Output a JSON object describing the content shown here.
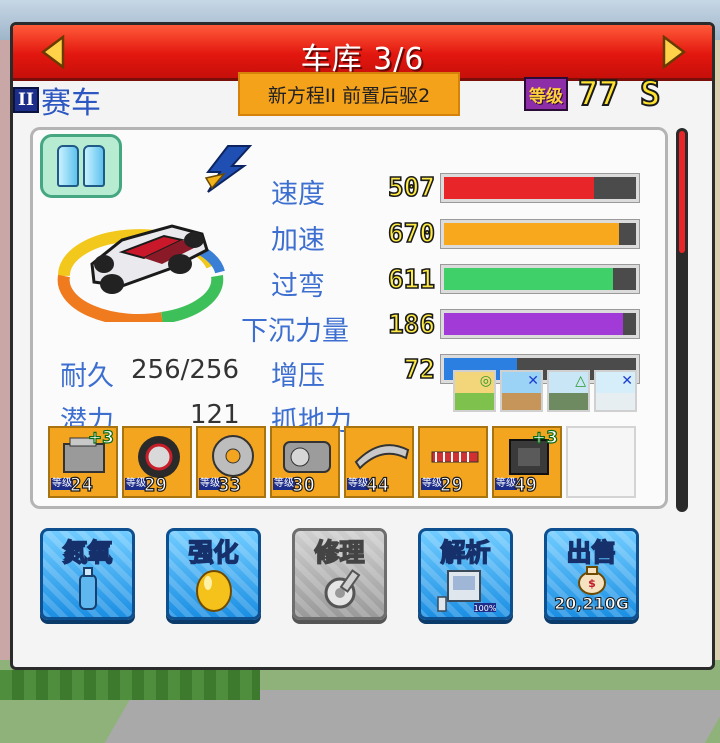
{
  "window": {
    "title": "车库 3/6"
  },
  "car": {
    "rank": "II",
    "name": "赛车",
    "spec": "新方程II 前置后驱2",
    "level_label": "等级",
    "level": "77",
    "grade": "S"
  },
  "stats": [
    {
      "label": "速度",
      "value": "507",
      "fill": 0.78,
      "color": "#e8262a"
    },
    {
      "label": "加速",
      "value": "670",
      "fill": 0.91,
      "color": "#f7a81d"
    },
    {
      "label": "过弯",
      "value": "611",
      "fill": 0.88,
      "color": "#3fd06a"
    },
    {
      "label": "下沉力量",
      "value": "186",
      "fill": 0.93,
      "color": "#a13ad6"
    },
    {
      "label": "增压",
      "value": "72",
      "fill": 0.38,
      "color": "#2a7fe0"
    }
  ],
  "durability": {
    "label": "耐久",
    "value": "256/256"
  },
  "potential": {
    "label": "潜力",
    "value": "121"
  },
  "grip": {
    "label": "抓地力",
    "icons": [
      {
        "name": "sunny-road-grip-icon",
        "mark": "◎",
        "sky": "#f3d57a",
        "ground": "#7ec24d"
      },
      {
        "name": "rain-road-grip-icon",
        "mark": "✕",
        "sky": "#9ad3f5",
        "ground": "#c6955a"
      },
      {
        "name": "rough-road-grip-icon",
        "mark": "△",
        "sky": "#c8e6f6",
        "ground": "#6d8a60"
      },
      {
        "name": "snow-road-grip-icon",
        "mark": "✕",
        "sky": "#d5eef9",
        "ground": "#e7eef2"
      }
    ]
  },
  "parts": [
    {
      "name": "engine-part",
      "level": "24",
      "plus": "+3"
    },
    {
      "name": "tire-part",
      "level": "29",
      "plus": ""
    },
    {
      "name": "brake-part",
      "level": "33",
      "plus": ""
    },
    {
      "name": "turbo-part",
      "level": "30",
      "plus": ""
    },
    {
      "name": "wing-part",
      "level": "44",
      "plus": ""
    },
    {
      "name": "suspension-part",
      "level": "29",
      "plus": ""
    },
    {
      "name": "chip-part",
      "level": "49",
      "plus": "+3"
    }
  ],
  "parts_level_tag": "等级",
  "actions": {
    "nitro": "氮氧",
    "upgrade": "强化",
    "repair": "修理",
    "analyze": "解析",
    "sell": "出售",
    "sell_price": "20,210G",
    "analyze_badge": "100%"
  },
  "colors": {
    "title_bar": "#e3170f",
    "label_blue": "#3d6fd0",
    "button_blue": "#1c8fe3",
    "part_orange": "#f4a51f"
  }
}
